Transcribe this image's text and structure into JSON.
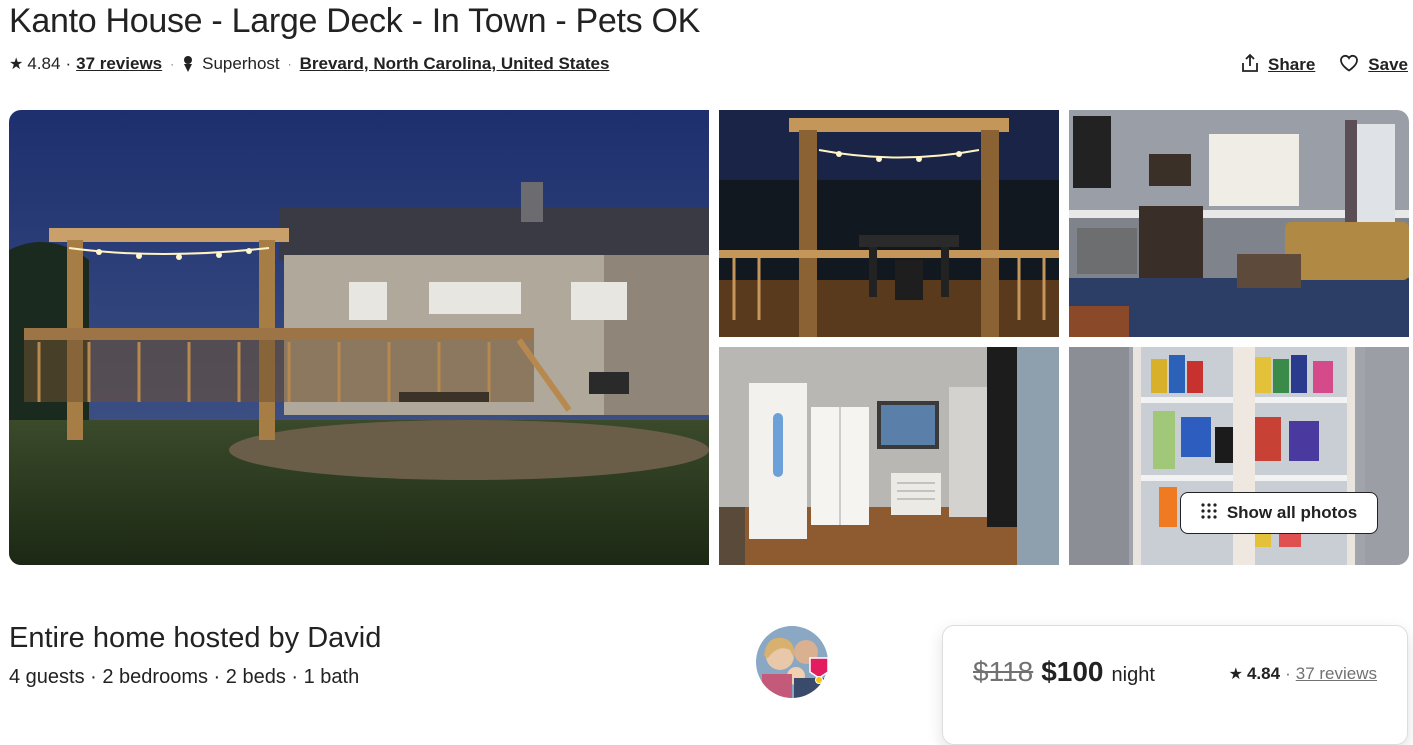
{
  "listing": {
    "title": "Kanto House - Large Deck - In Town - Pets OK",
    "rating": "4.84",
    "reviews": "37 reviews",
    "host_status": "Superhost",
    "location": "Brevard, North Carolina, United States"
  },
  "actions": {
    "share": "Share",
    "save": "Save"
  },
  "gallery": {
    "show_all": "Show all photos",
    "photos": [
      "deck-exterior-night",
      "pergola-deck-dining",
      "living-room",
      "entry-hall-closet",
      "game-collection-shelf"
    ]
  },
  "host": {
    "title": "Entire home hosted by David",
    "details": "4 guests · 2 bedrooms · 2 beds · 1 bath"
  },
  "booking": {
    "old_price": "$118",
    "price": "$100",
    "per": "night",
    "rating": "4.84",
    "reviews": "37 reviews"
  },
  "icons": [
    "star-icon",
    "superhost-icon",
    "share-icon",
    "heart-icon",
    "grid-icon"
  ],
  "colors": {
    "text": "#222222",
    "muted": "#717171",
    "badge": "#e31c5f"
  }
}
